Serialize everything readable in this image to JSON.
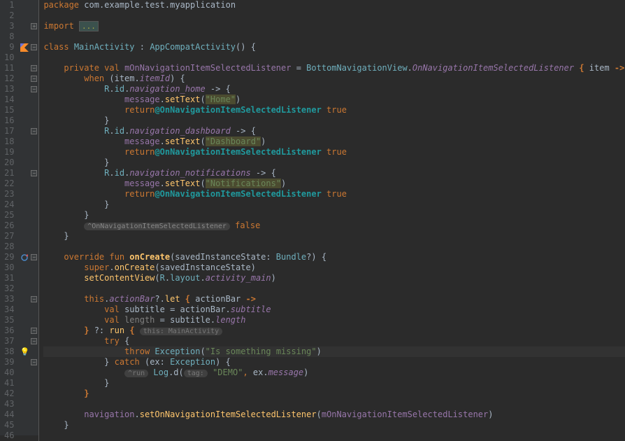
{
  "lines": [
    {
      "n": 1,
      "fold": "",
      "marker": "",
      "tokens": [
        [
          "kw",
          "package "
        ],
        [
          "pkg",
          "com"
        ],
        [
          "op",
          "."
        ],
        [
          "pkg",
          "example"
        ],
        [
          "op",
          "."
        ],
        [
          "pkg",
          "test"
        ],
        [
          "op",
          "."
        ],
        [
          "pkg",
          "myapplication"
        ]
      ]
    },
    {
      "n": 2,
      "fold": "",
      "marker": "",
      "tokens": []
    },
    {
      "n": 3,
      "fold": "plus",
      "marker": "",
      "tokens": [
        [
          "kw",
          "import "
        ],
        [
          "foldbox",
          "..."
        ]
      ]
    },
    {
      "n": 8,
      "fold": "",
      "marker": "",
      "tokens": []
    },
    {
      "n": 9,
      "fold": "minus",
      "marker": "kt",
      "tokens": [
        [
          "kw",
          "class "
        ],
        [
          "cls",
          "MainActivity"
        ],
        [
          "op",
          " : "
        ],
        [
          "cls",
          "AppCompatActivity"
        ],
        [
          "op",
          "() {"
        ]
      ]
    },
    {
      "n": 10,
      "fold": "",
      "marker": "",
      "tokens": []
    },
    {
      "n": 11,
      "fold": "minus",
      "marker": "",
      "tokens": [
        [
          "pad",
          "    "
        ],
        [
          "kw",
          "private val "
        ],
        [
          "id",
          "mOnNavigationItemSelectedListener"
        ],
        [
          "op",
          " = "
        ],
        [
          "cls",
          "BottomNavigationView"
        ],
        [
          "op",
          "."
        ],
        [
          "it",
          "OnNavigationItemSelectedListener"
        ],
        [
          "op",
          " "
        ],
        [
          "kw-b",
          "{"
        ],
        [
          "op",
          " item "
        ],
        [
          "kw-b",
          "->"
        ]
      ]
    },
    {
      "n": 12,
      "fold": "minus",
      "marker": "",
      "tokens": [
        [
          "pad",
          "        "
        ],
        [
          "kw",
          "when "
        ],
        [
          "op",
          "(item."
        ],
        [
          "it",
          "itemId"
        ],
        [
          "op",
          ") {"
        ]
      ]
    },
    {
      "n": 13,
      "fold": "minus",
      "marker": "",
      "tokens": [
        [
          "pad",
          "            "
        ],
        [
          "cls",
          "R"
        ],
        [
          "op",
          "."
        ],
        [
          "cls",
          "id"
        ],
        [
          "op",
          "."
        ],
        [
          "it",
          "navigation_home"
        ],
        [
          "op",
          " -> {"
        ]
      ]
    },
    {
      "n": 14,
      "fold": "",
      "marker": "",
      "tokens": [
        [
          "pad",
          "                "
        ],
        [
          "id",
          "message"
        ],
        [
          "op",
          "."
        ],
        [
          "fn",
          "setText"
        ],
        [
          "op",
          "("
        ],
        [
          "strhl",
          "\"Home\""
        ],
        [
          "op",
          ")"
        ]
      ]
    },
    {
      "n": 15,
      "fold": "",
      "marker": "",
      "tokens": [
        [
          "pad",
          "                "
        ],
        [
          "kw",
          "return"
        ],
        [
          "lbl",
          "@OnNavigationItemSelectedListener "
        ],
        [
          "kw",
          "true"
        ]
      ]
    },
    {
      "n": 16,
      "fold": "",
      "marker": "",
      "tokens": [
        [
          "pad",
          "            "
        ],
        [
          "op",
          "}"
        ]
      ]
    },
    {
      "n": 17,
      "fold": "minus",
      "marker": "",
      "tokens": [
        [
          "pad",
          "            "
        ],
        [
          "cls",
          "R"
        ],
        [
          "op",
          "."
        ],
        [
          "cls",
          "id"
        ],
        [
          "op",
          "."
        ],
        [
          "it",
          "navigation_dashboard"
        ],
        [
          "op",
          " -> {"
        ]
      ]
    },
    {
      "n": 18,
      "fold": "",
      "marker": "",
      "tokens": [
        [
          "pad",
          "                "
        ],
        [
          "id",
          "message"
        ],
        [
          "op",
          "."
        ],
        [
          "fn",
          "setText"
        ],
        [
          "op",
          "("
        ],
        [
          "strhl",
          "\"Dashboard\""
        ],
        [
          "op",
          ")"
        ]
      ]
    },
    {
      "n": 19,
      "fold": "",
      "marker": "",
      "tokens": [
        [
          "pad",
          "                "
        ],
        [
          "kw",
          "return"
        ],
        [
          "lbl",
          "@OnNavigationItemSelectedListener "
        ],
        [
          "kw",
          "true"
        ]
      ]
    },
    {
      "n": 20,
      "fold": "",
      "marker": "",
      "tokens": [
        [
          "pad",
          "            "
        ],
        [
          "op",
          "}"
        ]
      ]
    },
    {
      "n": 21,
      "fold": "minus",
      "marker": "",
      "tokens": [
        [
          "pad",
          "            "
        ],
        [
          "cls",
          "R"
        ],
        [
          "op",
          "."
        ],
        [
          "cls",
          "id"
        ],
        [
          "op",
          "."
        ],
        [
          "it",
          "navigation_notifications"
        ],
        [
          "op",
          " -> {"
        ]
      ]
    },
    {
      "n": 22,
      "fold": "",
      "marker": "",
      "tokens": [
        [
          "pad",
          "                "
        ],
        [
          "id",
          "message"
        ],
        [
          "op",
          "."
        ],
        [
          "fn",
          "setText"
        ],
        [
          "op",
          "("
        ],
        [
          "strhl",
          "\"Notifications\""
        ],
        [
          "op",
          ")"
        ]
      ]
    },
    {
      "n": 23,
      "fold": "",
      "marker": "",
      "tokens": [
        [
          "pad",
          "                "
        ],
        [
          "kw",
          "return"
        ],
        [
          "lbl",
          "@OnNavigationItemSelectedListener "
        ],
        [
          "kw",
          "true"
        ]
      ]
    },
    {
      "n": 24,
      "fold": "",
      "marker": "",
      "tokens": [
        [
          "pad",
          "            "
        ],
        [
          "op",
          "}"
        ]
      ]
    },
    {
      "n": 25,
      "fold": "",
      "marker": "",
      "tokens": [
        [
          "pad",
          "        "
        ],
        [
          "op",
          "}"
        ]
      ]
    },
    {
      "n": 26,
      "fold": "",
      "marker": "",
      "tokens": [
        [
          "pad",
          "        "
        ],
        [
          "ann",
          "^OnNavigationItemSelectedListener"
        ],
        [
          "op",
          " "
        ],
        [
          "kw",
          "false"
        ]
      ]
    },
    {
      "n": 27,
      "fold": "",
      "marker": "",
      "tokens": [
        [
          "pad",
          "    "
        ],
        [
          "op",
          "}"
        ]
      ]
    },
    {
      "n": 28,
      "fold": "",
      "marker": "",
      "tokens": []
    },
    {
      "n": 29,
      "fold": "minus",
      "marker": "ov",
      "tokens": [
        [
          "pad",
          "    "
        ],
        [
          "kw",
          "override fun "
        ],
        [
          "fnb",
          "onCreate"
        ],
        [
          "op",
          "(savedInstanceState: "
        ],
        [
          "cls",
          "Bundle"
        ],
        [
          "op",
          "?) {"
        ]
      ]
    },
    {
      "n": 30,
      "fold": "",
      "marker": "",
      "tokens": [
        [
          "pad",
          "        "
        ],
        [
          "kw",
          "super"
        ],
        [
          "op",
          "."
        ],
        [
          "fn",
          "onCreate"
        ],
        [
          "op",
          "(savedInstanceState)"
        ]
      ]
    },
    {
      "n": 31,
      "fold": "",
      "marker": "",
      "tokens": [
        [
          "pad",
          "        "
        ],
        [
          "fn",
          "setContentView"
        ],
        [
          "op",
          "("
        ],
        [
          "cls",
          "R"
        ],
        [
          "op",
          "."
        ],
        [
          "cls",
          "layout"
        ],
        [
          "op",
          "."
        ],
        [
          "it",
          "activity_main"
        ],
        [
          "op",
          ")"
        ]
      ]
    },
    {
      "n": 32,
      "fold": "",
      "marker": "",
      "tokens": []
    },
    {
      "n": 33,
      "fold": "minus",
      "marker": "",
      "tokens": [
        [
          "pad",
          "        "
        ],
        [
          "kw",
          "this"
        ],
        [
          "op",
          "."
        ],
        [
          "it",
          "actionBar"
        ],
        [
          "op",
          "?."
        ],
        [
          "fn",
          "let"
        ],
        [
          "op",
          " "
        ],
        [
          "kw-b",
          "{"
        ],
        [
          "op",
          " actionBar "
        ],
        [
          "kw-b",
          "->"
        ]
      ]
    },
    {
      "n": 34,
      "fold": "",
      "marker": "",
      "tokens": [
        [
          "pad",
          "            "
        ],
        [
          "kw",
          "val "
        ],
        [
          "op",
          "subtitle = actionBar."
        ],
        [
          "it",
          "subtitle"
        ]
      ]
    },
    {
      "n": 35,
      "fold": "",
      "marker": "",
      "tokens": [
        [
          "pad",
          "            "
        ],
        [
          "kw",
          "val "
        ],
        [
          "dim",
          "length"
        ],
        [
          "op",
          " = subtitle."
        ],
        [
          "it",
          "length"
        ]
      ]
    },
    {
      "n": 36,
      "fold": "minus",
      "marker": "",
      "tokens": [
        [
          "pad",
          "        "
        ],
        [
          "kw-b",
          "}"
        ],
        [
          "op",
          " ?: "
        ],
        [
          "fn",
          "run"
        ],
        [
          "op",
          " "
        ],
        [
          "kw-b",
          "{"
        ],
        [
          "op",
          " "
        ],
        [
          "ann2",
          "this: MainActivity"
        ]
      ]
    },
    {
      "n": 37,
      "fold": "minus",
      "marker": "",
      "tokens": [
        [
          "pad",
          "            "
        ],
        [
          "kw",
          "try "
        ],
        [
          "op",
          "{"
        ]
      ]
    },
    {
      "n": 38,
      "fold": "",
      "marker": "bulb",
      "hl": true,
      "tokens": [
        [
          "pad",
          "                "
        ],
        [
          "kw",
          "throw "
        ],
        [
          "cls",
          "Exception"
        ],
        [
          "op",
          "("
        ],
        [
          "str",
          "\"Is something missing\""
        ],
        [
          "op",
          ")"
        ]
      ]
    },
    {
      "n": 39,
      "fold": "minus",
      "marker": "",
      "tokens": [
        [
          "pad",
          "            "
        ],
        [
          "op",
          "} "
        ],
        [
          "kw",
          "catch "
        ],
        [
          "op",
          "(ex: "
        ],
        [
          "cls",
          "Exception"
        ],
        [
          "op",
          ") {"
        ]
      ]
    },
    {
      "n": 40,
      "fold": "",
      "marker": "",
      "tokens": [
        [
          "pad",
          "                "
        ],
        [
          "ann2",
          "^run"
        ],
        [
          "op",
          " "
        ],
        [
          "cls",
          "Log"
        ],
        [
          "op",
          ".d("
        ],
        [
          "ann2",
          "tag:"
        ],
        [
          "op",
          " "
        ],
        [
          "str",
          "\"DEMO\""
        ],
        [
          "kw",
          ","
        ],
        [
          "op",
          " ex."
        ],
        [
          "it",
          "message"
        ],
        [
          "op",
          ")"
        ]
      ]
    },
    {
      "n": 41,
      "fold": "",
      "marker": "",
      "tokens": [
        [
          "pad",
          "            "
        ],
        [
          "op",
          "}"
        ]
      ]
    },
    {
      "n": 42,
      "fold": "",
      "marker": "",
      "tokens": [
        [
          "pad",
          "        "
        ],
        [
          "kw-b",
          "}"
        ]
      ]
    },
    {
      "n": 43,
      "fold": "",
      "marker": "",
      "tokens": []
    },
    {
      "n": 44,
      "fold": "",
      "marker": "",
      "tokens": [
        [
          "pad",
          "        "
        ],
        [
          "id",
          "navigation"
        ],
        [
          "op",
          "."
        ],
        [
          "fn",
          "setOnNavigationItemSelectedListener"
        ],
        [
          "op",
          "("
        ],
        [
          "id",
          "mOnNavigationItemSelectedListener"
        ],
        [
          "op",
          ")"
        ]
      ]
    },
    {
      "n": 45,
      "fold": "",
      "marker": "",
      "tokens": [
        [
          "pad",
          "    "
        ],
        [
          "op",
          "}"
        ]
      ]
    },
    {
      "n": 46,
      "fold": "",
      "marker": "",
      "tokens": []
    }
  ]
}
